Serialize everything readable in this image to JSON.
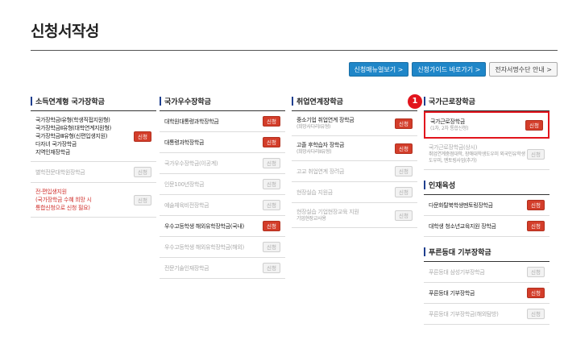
{
  "page": {
    "title": "신청서작성"
  },
  "top_buttons": [
    {
      "label": "신청매뉴얼보기 >",
      "style": "blue"
    },
    {
      "label": "신청가이드 바로가기 >",
      "style": "blue"
    },
    {
      "label": "전자서명수단 안내 >",
      "style": "plain"
    }
  ],
  "colors": {
    "accent_blue": "#1f86c8",
    "apply_red": "#d33d2a",
    "highlight_red": "#e2141c",
    "heading_bar": "#1f3f8f"
  },
  "columns": [
    {
      "heading": "소득연계형 국가장학금",
      "rows": [
        {
          "lines": [
            "국가장학금Ⅰ유형(학생직접지원형)",
            "국가장학금Ⅱ유형(대학연계지원형)",
            "국가장학금Ⅲ유형(신편입생지원)",
            "다자녀 국가장학금",
            "지역인재장학금"
          ],
          "button": "신청",
          "active": true
        },
        {
          "lines": [
            "별학전문대학원장학금"
          ],
          "button": "신청",
          "active": false
        },
        {
          "lines": [
            "전·편입생지원",
            "(국가장학금 수혜 희망 시",
            "통합신청으로 신청 필요)"
          ],
          "button": "신청",
          "active": false,
          "red": true
        }
      ]
    },
    {
      "heading": "국가우수장학금",
      "rows": [
        {
          "lines": [
            "대학원대통령과학장학금"
          ],
          "button": "신청",
          "active": true
        },
        {
          "lines": [
            "대통령과학장학금"
          ],
          "button": "신청",
          "active": true
        },
        {
          "lines": [
            "국가우수장학금(이공계)"
          ],
          "button": "신청",
          "active": false
        },
        {
          "lines": [
            "인문100년장학금"
          ],
          "button": "신청",
          "active": false
        },
        {
          "lines": [
            "예술체육비전장학금"
          ],
          "button": "신청",
          "active": false
        },
        {
          "lines": [
            "우수고등학생 해외유학장학금(국내)"
          ],
          "button": "신청",
          "active": true
        },
        {
          "lines": [
            "우수고등학생 해외유학장학금(해외)"
          ],
          "button": "신청",
          "active": false
        },
        {
          "lines": [
            "전문기술인재장학금"
          ],
          "button": "신청",
          "active": false
        }
      ]
    },
    {
      "heading": "취업연계장학금",
      "rows": [
        {
          "lines": [
            "중소기업 취업연계 장학금"
          ],
          "sub": "(희망사다리Ⅰ유형)",
          "button": "신청",
          "active": true
        },
        {
          "lines": [
            "고졸 후학습자 장학금"
          ],
          "sub": "(희망사다리Ⅱ유형)",
          "button": "신청",
          "active": true
        },
        {
          "lines": [
            "고교 취업연계 장려금"
          ],
          "button": "신청",
          "active": false
        },
        {
          "lines": [
            "현장실습 지원금"
          ],
          "button": "신청",
          "active": false
        },
        {
          "lines": [
            "현장실습 기업현장교육 지원"
          ],
          "sub": "기업현장교사용",
          "button": "신청",
          "active": false
        }
      ]
    },
    {
      "heading": "국가근로장학금",
      "badge": "1",
      "rows": [
        {
          "lines": [
            "국가근로장학금"
          ],
          "sub": "(1차, 2차 통합신청)",
          "button": "신청",
          "active": true,
          "highlight": true
        },
        {
          "lines": [
            "국가근로장학금(상시)"
          ],
          "sub": "취업연계중점대학, 장애대학생도우미 외국인유학생도우미, 멘토링사업(추가)",
          "button": "신청",
          "active": false
        }
      ],
      "sections": [
        {
          "heading": "인재육성",
          "rows": [
            {
              "lines": [
                "다문화탈북학생멘토링장학금"
              ],
              "button": "신청",
              "active": true
            },
            {
              "lines": [
                "대학생 청소년교육지원 장학금"
              ],
              "button": "신청",
              "active": true
            }
          ]
        },
        {
          "heading": "푸른등대 기부장학금",
          "rows": [
            {
              "lines": [
                "푸른등대 삼성기부장학금"
              ],
              "button": "신청",
              "active": false
            },
            {
              "lines": [
                "푸른등대 기부장학금"
              ],
              "button": "신청",
              "active": true
            },
            {
              "lines": [
                "푸른등대 기부장학금(해외탐방)"
              ],
              "button": "신청",
              "active": false
            }
          ]
        }
      ]
    }
  ]
}
